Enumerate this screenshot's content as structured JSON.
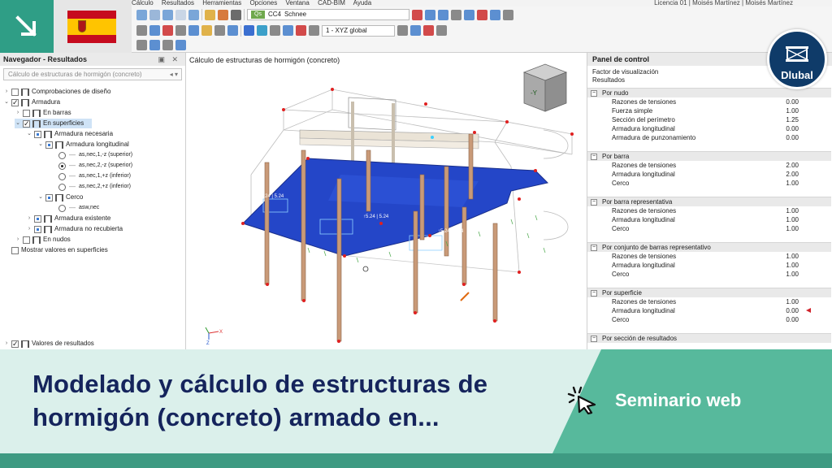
{
  "menubar": {
    "items": [
      "Cálculo",
      "Resultados",
      "Herramientas",
      "Opciones",
      "Ventana",
      "CAD-BIM",
      "Ayuda"
    ],
    "license": "Licencia 01 | Moisés Martínez | Moisés Martínez"
  },
  "toolbar": {
    "load_chip": "Qs",
    "load_case": "CC4",
    "load_name": "Schnee",
    "view_combo": "1 - XYZ global"
  },
  "navigator": {
    "title": "Navegador - Resultados",
    "combo": "Cálculo de estructuras de hormigón (concreto)",
    "items": [
      {
        "label": "Comprobaciones de diseño"
      },
      {
        "label": "Armadura"
      },
      {
        "label": "En barras"
      },
      {
        "label": "En superficies"
      },
      {
        "label": "Armadura necesaria"
      },
      {
        "label": "Armadura longitudinal"
      },
      {
        "label": "as,nec,1,-z (superior)"
      },
      {
        "label": "as,nec,2,-z (superior)"
      },
      {
        "label": "as,nec,1,+z (inferior)"
      },
      {
        "label": "as,nec,2,+z (inferior)"
      },
      {
        "label": "Cerco"
      },
      {
        "label": "asw,nec"
      },
      {
        "label": "Armadura existente"
      },
      {
        "label": "Armadura no recubierta"
      },
      {
        "label": "En nudos"
      },
      {
        "label": "Mostrar valores en superficies"
      },
      {
        "label": "Valores de resultados"
      }
    ]
  },
  "viewport": {
    "title": "Cálculo de estructuras de hormigón (concreto)",
    "labels": [
      "↑5.24 | 5.24",
      "↑5.24 | 5.24",
      "5.24 | 5.24"
    ],
    "axes": {
      "x": "X",
      "z": "Z"
    },
    "cube_label": "-Y"
  },
  "panel": {
    "title": "Panel de control",
    "head1": "Factor de visualización",
    "head2": "Resultados",
    "groups": [
      {
        "title": "Por nudo",
        "rows": [
          {
            "label": "Razones de tensiones",
            "value": "0.00"
          },
          {
            "label": "Fuerza simple",
            "value": "1.00"
          },
          {
            "label": "Sección del perímetro",
            "value": "1.25"
          },
          {
            "label": "Armadura longitudinal",
            "value": "0.00"
          },
          {
            "label": "Armadura de punzonamiento",
            "value": "0.00"
          }
        ]
      },
      {
        "title": "Por barra",
        "rows": [
          {
            "label": "Razones de tensiones",
            "value": "2.00"
          },
          {
            "label": "Armadura longitudinal",
            "value": "2.00"
          },
          {
            "label": "Cerco",
            "value": "1.00"
          }
        ]
      },
      {
        "title": "Por barra representativa",
        "rows": [
          {
            "label": "Razones de tensiones",
            "value": "1.00"
          },
          {
            "label": "Armadura longitudinal",
            "value": "1.00"
          },
          {
            "label": "Cerco",
            "value": "1.00"
          }
        ]
      },
      {
        "title": "Por conjunto de barras representativo",
        "rows": [
          {
            "label": "Razones de tensiones",
            "value": "1.00"
          },
          {
            "label": "Armadura longitudinal",
            "value": "1.00"
          },
          {
            "label": "Cerco",
            "value": "1.00"
          }
        ]
      },
      {
        "title": "Por superficie",
        "rows": [
          {
            "label": "Razones de tensiones",
            "value": "1.00"
          },
          {
            "label": "Armadura longitudinal",
            "value": "0.00"
          },
          {
            "label": "Cerco",
            "value": "0.00"
          }
        ]
      },
      {
        "title": "Por sección de resultados",
        "rows": []
      }
    ]
  },
  "logo": {
    "word": "Dlubal"
  },
  "banner": {
    "headline_line1": "Modelado y cálculo de estructuras de",
    "headline_line2": "hormigón (concreto) armado en...",
    "tag": "Seminario web"
  },
  "colors": {
    "teal": "#2f9e86",
    "banner_bg": "#dbf0eb",
    "banner_green": "#57b99c",
    "headline": "#15245c",
    "slab_blue": "#2446c8",
    "logo_navy": "#0f3b69"
  }
}
